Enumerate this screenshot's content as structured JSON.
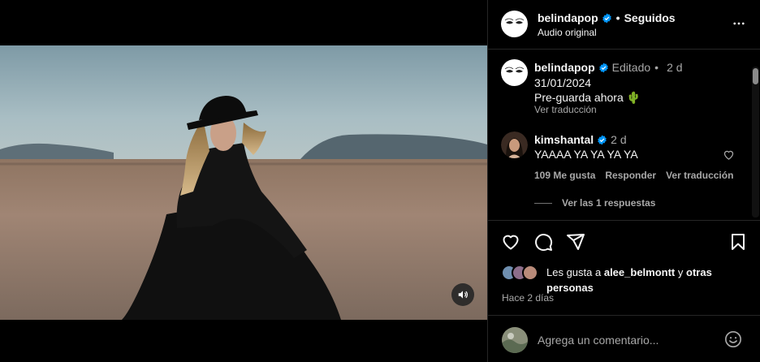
{
  "post": {
    "username": "belindapop",
    "follow_status": "Seguidos",
    "audio": "Audio original"
  },
  "caption": {
    "username": "belindapop",
    "edited": "Editado",
    "age": "2 d",
    "date": "31/01/2024",
    "text": "Pre-guarda ahora 🌵",
    "translate": "Ver traducción"
  },
  "comment": {
    "username": "kimshantal",
    "age": "2 d",
    "text": "YAAAA YA YA YA YA",
    "likes": "109 Me gusta",
    "reply": "Responder",
    "translate": "Ver traducción",
    "view_replies": "Ver las 1 respuestas"
  },
  "likes_summary": {
    "prefix": "Les gusta a",
    "user": "alee_belmontt",
    "conjunction": "y",
    "others": "otras personas"
  },
  "timestamp": "Hace 2 días",
  "composer": {
    "placeholder": "Agrega un comentario..."
  },
  "icons": {
    "mute": "speaker-icon",
    "more": "more-options-icon",
    "like": "heart-icon",
    "comment": "comment-icon",
    "share": "send-icon",
    "save": "bookmark-icon",
    "emoji": "emoji-icon",
    "verified": "verified-badge-icon"
  },
  "colors": {
    "background": "#000000",
    "text": "#f5f5f5",
    "secondary": "#a8a8a8",
    "verified": "#0095f6",
    "divider": "#262626"
  }
}
